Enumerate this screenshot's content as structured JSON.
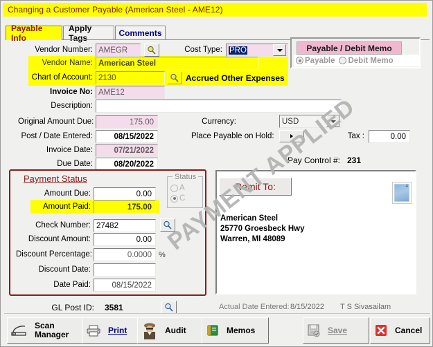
{
  "window": {
    "title": "Changing a Customer Payable  (American Steel - AME12)"
  },
  "tabs": [
    {
      "label": "Payable Info",
      "selected": true
    },
    {
      "label": "Apply Tags",
      "selected": false
    },
    {
      "label": "Comments",
      "selected": false
    }
  ],
  "watermark": "PAYMENT APPLIED",
  "form": {
    "vendor_number_label": "Vendor Number:",
    "vendor_number_value": "AMEGR",
    "cost_type_label": "Cost Type:",
    "cost_type_value": "PRO",
    "vendor_name_label": "Vendor Name:",
    "vendor_name_value": "American Steel",
    "chart_of_account_label": "Chart of Account:",
    "chart_of_account_value": "2130",
    "chart_of_account_desc": "Accrued  Other Expenses",
    "invoice_no_label": "Invoice No:",
    "invoice_no_value": "AME12",
    "description_label": "Description:",
    "description_value": "",
    "original_amount_due_label": "Original Amount Due:",
    "original_amount_due_value": "175.00",
    "post_date_entered_label": "Post / Date Entered:",
    "post_date_entered_value": "08/15/2022",
    "invoice_date_label": "Invoice Date:",
    "invoice_date_value": "07/21/2022",
    "due_date_label": "Due Date:",
    "due_date_value": "08/20/2022",
    "currency_label": "Currency:",
    "currency_value": "USD",
    "place_on_hold_label": "Place Payable on Hold:",
    "tax_label": "Tax :",
    "tax_value": "0.00",
    "pay_control_label": "Pay Control #:",
    "pay_control_value": "231"
  },
  "payable_group": {
    "title": "Payable / Debit Memo",
    "option_payable": "Payable",
    "option_debit_memo": "Debit Memo",
    "selected": "Payable"
  },
  "payment_status": {
    "title": "Payment Status",
    "amount_due_label": "Amount Due:",
    "amount_due_value": "0.00",
    "amount_paid_label": "Amount Paid:",
    "amount_paid_value": "175.00",
    "check_number_label": "Check Number:",
    "check_number_value": "27482",
    "discount_amount_label": "Discount Amount:",
    "discount_amount_value": "0.00",
    "discount_percentage_label": "Discount Percentage:",
    "discount_percentage_value": "0.0000",
    "percent_sign": "%",
    "discount_date_label": "Discount Date:",
    "discount_date_value": "",
    "date_paid_label": "Date Paid:",
    "date_paid_value": "08/15/2022",
    "status_legend": "Status",
    "status_option_a": "A",
    "status_option_c": "C",
    "status_selected": "C"
  },
  "remit": {
    "button_label": "Remit To:",
    "address": "American Steel\n25770 Groesbeck Hwy\nWarren, MI 48089",
    "thumbnail_badge": "4"
  },
  "footer": {
    "gl_post_id_label": "GL Post ID:",
    "gl_post_id_value": "3581",
    "actual_date_label": "Actual Date Entered:",
    "actual_date_value": "8/15/2022",
    "user_name": "T S Sivasailam"
  },
  "buttons": {
    "scan_manager_line1": "Scan",
    "scan_manager_line2": "Manager",
    "print": "Print",
    "audit": "Audit",
    "memos": "Memos",
    "save": "Save",
    "cancel": "Cancel"
  },
  "colors": {
    "title_bar": "#ffff00",
    "highlight": "#ffff00",
    "readonly_field": "#f5dcec",
    "panel_border_red": "#8a1b1b",
    "pink_header": "#f0b8cf",
    "cancel_red": "#e03030"
  }
}
